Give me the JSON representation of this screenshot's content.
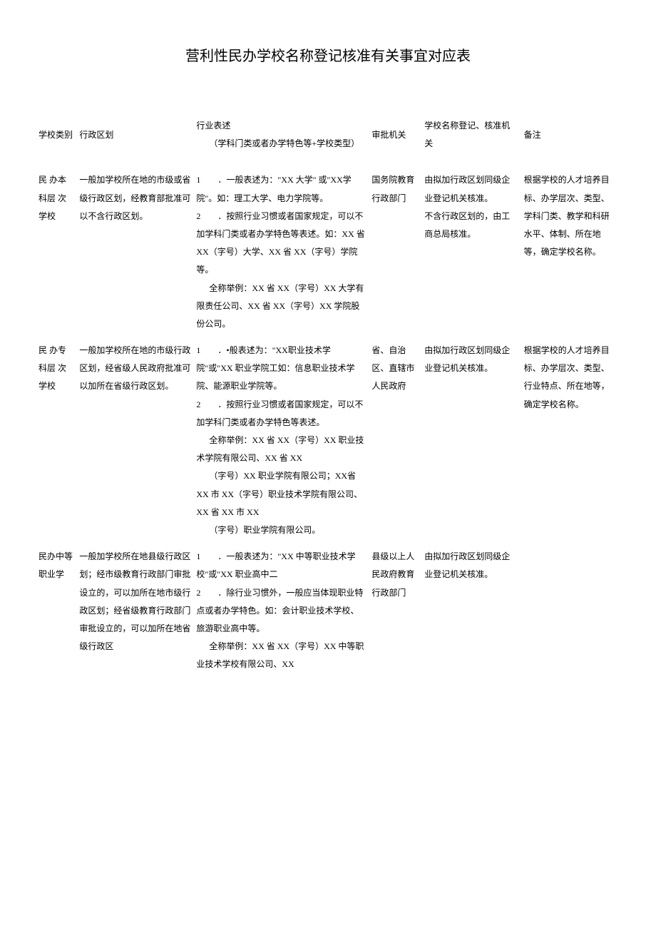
{
  "title": "营利性民办学校名称登记核准有关事宜对应表",
  "headers": {
    "col1": "学校类别",
    "col2": "行政区划",
    "col3": "行业表述",
    "col3_sub": "（学科门类或者办学特色等+学校类型）",
    "col4": "审批机关",
    "col5": "学校名称登记、核准机关",
    "col6": "备注"
  },
  "rows": [
    {
      "category": "民 办本 科层 次学校",
      "district": "一般加学校所在地的市级或省级行政区划，经教育部批准可以不含行政区划。",
      "industry_p1_num": "1",
      "industry_p1": "．一般表述为：\"XX 大学\" 或\"XX学院\"。如：理工大学、电力学院等。",
      "industry_p2_num": "2",
      "industry_p2": "．按照行业习惯或者国家规定，可以不加学科门类或者办学特色等表述。如：XX 省 XX（字号）大学、XX 省 XX（字号）学院等。",
      "industry_p3_label": "全称举例：",
      "industry_p3": "XX 省 XX（字号）XX 大学有限责任公司、XX 省 XX（字号）XX 学院股份公司。",
      "approval": "国务院教育行政部门",
      "registration": "由拟加行政区划同级企业登记机关核准。\n不含行政区划的，由工商总局核准。",
      "notes": "根据学校的人才培养目标、办学层次、类型、学科门类、教学和科研水平、体制、所在地等，确定学校名称。"
    },
    {
      "category": "民 办专 科层 次学校",
      "district": "一般加学校所在地的市级行政区划，经省级人民政府批准可以加所在省级行政区划。",
      "industry_p1_num": "1",
      "industry_p1": "．•般表述为：\"XX职业技术学院\"或\"XX 职业学院工如：信息职业技术学院、能源职业学院等。",
      "industry_p2_num": "2",
      "industry_p2": "．按照行业习惯或者国家规定，可以不加学科门类或者办学特色等表述。",
      "industry_p3_label": "全称举例：",
      "industry_p3": "XX 省 XX（字号）XX 职业技术学院有限公司、XX 省 XX",
      "industry_p4": "（字号）XX 职业学院有限公司；XX省 XX 市 XX（字号）职业技术学院有限公司、XX 省 XX 市 XX",
      "industry_p5": "（字号）职业学院有限公司。",
      "approval": "省、自治区、直辖市人民政府",
      "registration": "由拟加行政区划同级企业登记机关核准。",
      "notes": "根据学校的人才培养目标、办学层次、类型、行业特点、所在地等，确定学校名称。"
    },
    {
      "category": "民办中等职业学",
      "district": "一般加学校所在地县级行政区划；经市级教育行政部门审批设立的，可以加所在地市级行政区划；经省级教育行政部门审批设立的，可以加所在地省级行政区",
      "industry_p1_num": "1",
      "industry_p1": "．一般表述为：\"XX 中等职业技术学校\"或\"XX 职业高中二",
      "industry_p2_num": "2",
      "industry_p2": "．除行业习惯外，一般应当体现职业特点或者办学特色。如：会计职业技术学校、旅游职业高中等。",
      "industry_p3_label": "全称举例：",
      "industry_p3": "XX 省 XX（字号）XX 中等职业技术学校有限公司、XX",
      "approval": "县级以上人民政府教育行政部门",
      "registration": "由拟加行政区划同级企业登记机关核准。",
      "notes": ""
    }
  ]
}
